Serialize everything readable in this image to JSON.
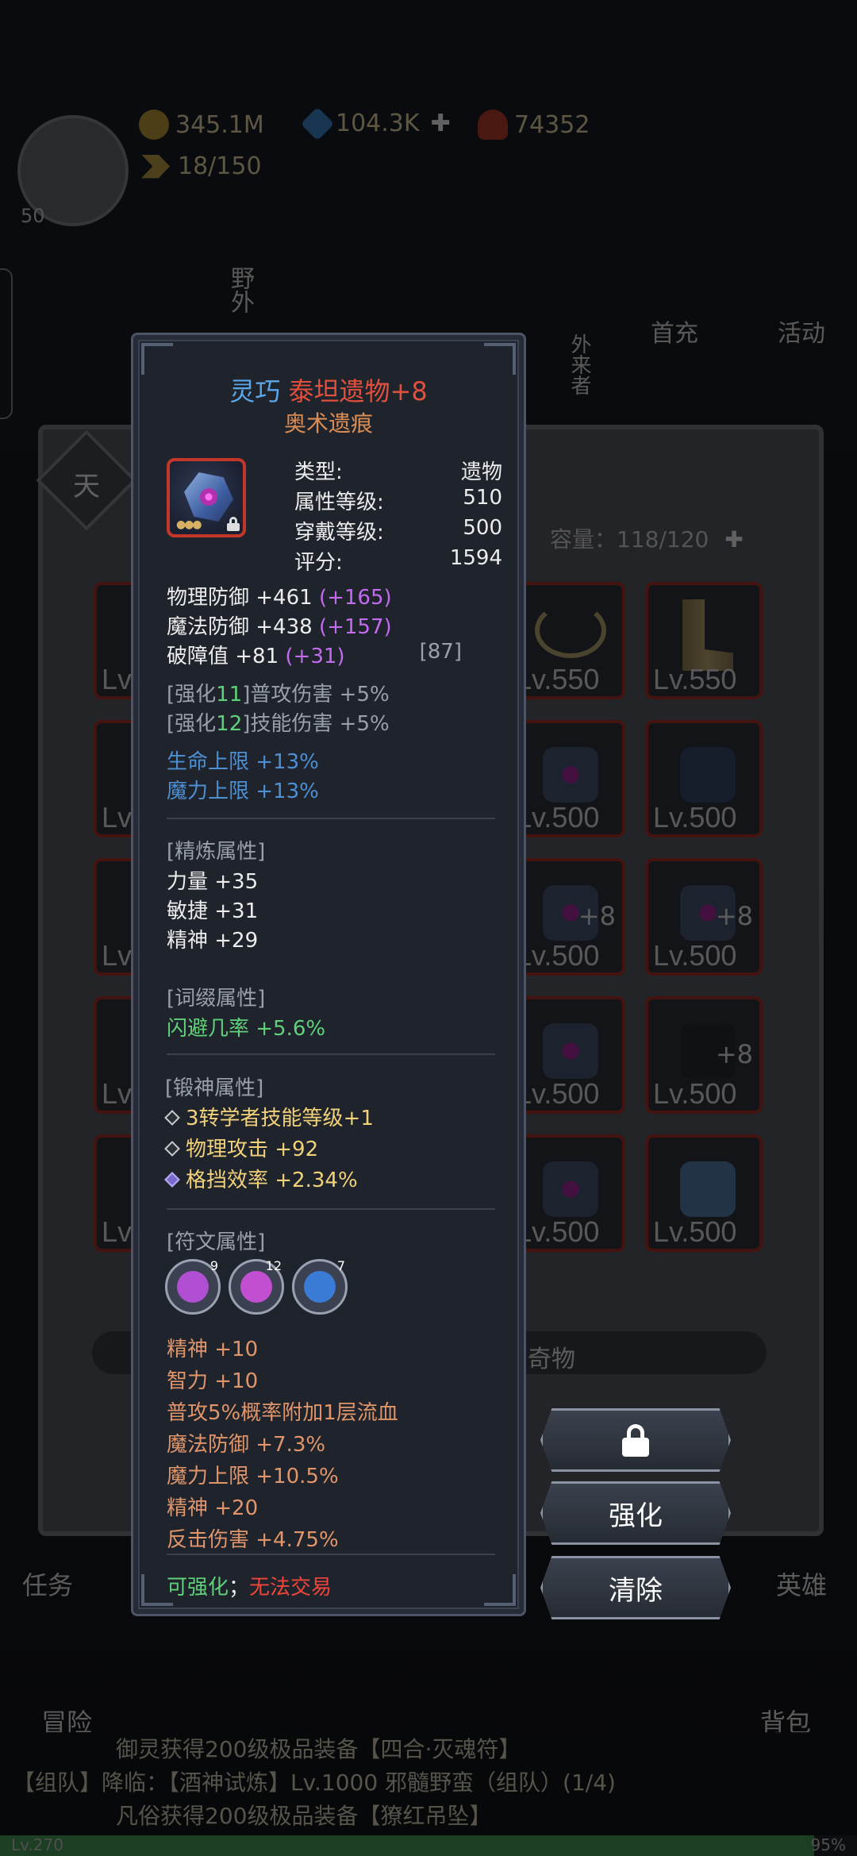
{
  "top": {
    "level": "50",
    "gold": "345.1M",
    "diamonds": "104.3K",
    "gems": "74352",
    "stamina": "18/150"
  },
  "menu": {
    "wild": "野外",
    "first_charge": "首充",
    "activity": "活动",
    "outer": "外来者"
  },
  "inventory": {
    "badge": "天",
    "capacity": "容量：118/120",
    "slots": [
      {
        "level": "Lv.550",
        "plus": ""
      },
      {
        "level": "Lv.550",
        "plus": ""
      },
      {
        "level": "Lv.500",
        "plus": ""
      },
      {
        "level": "Lv.500",
        "plus": ""
      },
      {
        "level": "Lv.500",
        "plus": "+8"
      },
      {
        "level": "Lv.500",
        "plus": "+8"
      },
      {
        "level": "Lv.500",
        "plus": ""
      },
      {
        "level": "Lv.500",
        "plus": "+8"
      },
      {
        "level": "Lv.500",
        "plus": ""
      },
      {
        "level": "Lv.500",
        "plus": ""
      }
    ],
    "left_col_lv": "Lv",
    "tab_curio": "奇物"
  },
  "buttons": {
    "enhance": "强化",
    "clear": "清除"
  },
  "bottom": {
    "task": "任务",
    "hero": "英雄",
    "adventure": "冒险",
    "bag": "背包",
    "news1": "御灵获得200级极品装备【四合·灭魂符】",
    "news2": "【组队】降临：【酒神试炼】Lv.1000 邪髓野蛮（组队）(1/4)",
    "news3": "凡俗获得200级极品装备【獠红吊坠】",
    "exp_level": "Lv.270",
    "exp_pct": "95%",
    "exp_fraction": 0.95
  },
  "tooltip": {
    "quality": "灵巧",
    "name": "泰坦遗物+8",
    "suffix": "奥术遗痕",
    "info": [
      {
        "label": "类型:",
        "value": "遗物"
      },
      {
        "label": "属性等级:",
        "value": "510"
      },
      {
        "label": "穿戴等级:",
        "value": "500"
      },
      {
        "label": "评分:",
        "value": "1594"
      }
    ],
    "base_stats": [
      {
        "text": "物理防御 +461",
        "bonus": "(+165)",
        "extra": ""
      },
      {
        "text": "魔法防御 +438",
        "bonus": "(+157)",
        "extra": ""
      },
      {
        "text": "破障值 +81",
        "bonus": "(+31)",
        "extra": "[87]"
      }
    ],
    "enhance": [
      {
        "pre": "[强化",
        "lv": "11",
        "post": "]普攻伤害 +5%"
      },
      {
        "pre": "[强化",
        "lv": "12",
        "post": "]技能伤害 +5%"
      }
    ],
    "set_bonus": [
      "生命上限 +13%",
      "魔力上限 +13%"
    ],
    "refine_header": "[精炼属性]",
    "refine": [
      "力量 +35",
      "敏捷 +31",
      "精神 +29"
    ],
    "affix_header": "[词缀属性]",
    "affix": [
      "闪避几率 +5.6%"
    ],
    "forge_header": "[锻神属性]",
    "forge": [
      "3转学者技能等级+1",
      "物理攻击 +92",
      "格挡效率 +2.34%"
    ],
    "rune_header": "[符文属性]",
    "runes": [
      {
        "icon": "eye-rune-icon",
        "count": "9",
        "color": "#b04fd1"
      },
      {
        "icon": "spark-rune-icon",
        "count": "12",
        "color": "#c24fd1"
      },
      {
        "icon": "drop-rune-icon",
        "count": "7",
        "color": "#3a7bd6"
      }
    ],
    "rune_stats": [
      "精神 +10",
      "智力 +10",
      "普攻5%概率附加1层流血",
      "魔法防御 +7.3%",
      "魔力上限 +10.5%",
      "精神 +20",
      "反击伤害 +4.75%"
    ],
    "footer_ok": "可强化",
    "footer_sep": "；",
    "footer_no": "无法交易"
  }
}
